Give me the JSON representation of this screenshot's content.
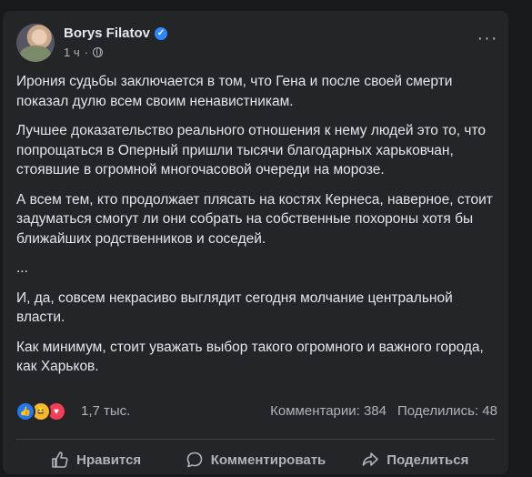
{
  "post": {
    "author": "Borys Filatov",
    "time": "1 ч",
    "paragraphs": [
      "Ирония судьбы заключается в том, что Гена и после своей смерти показал дулю всем своим ненавистникам.",
      "Лучшее доказательство реального отношения к нему людей это то, что попрощаться в Оперный пришли тысячи благодарных харьковчан, стоявшие в огромной многочасовой очереди на морозе.",
      "А всем тем, кто продолжает плясать на костях Кернеса, наверное, стоит задуматься смогут ли они собрать на собственные похороны хотя бы ближайших родственников и соседей.",
      "...",
      "И, да, совсем некрасиво выглядит сегодня молчание центральной власти.",
      "Как минимум, стоит уважать выбор такого огромного и важного города, как Харьков."
    ]
  },
  "reactions": {
    "icons": [
      "like-icon",
      "haha-icon",
      "love-icon"
    ],
    "count": "1,7 тыс.",
    "comments": "Комментарии: 384",
    "shares": "Поделились: 48"
  },
  "actions": {
    "like": "Нравится",
    "comment": "Комментировать",
    "share": "Поделиться"
  },
  "colors": {
    "background": "#18191a",
    "card": "#242526",
    "text": "#e4e6eb",
    "secondary": "#b0b3b8",
    "accent": "#2d88ff"
  }
}
